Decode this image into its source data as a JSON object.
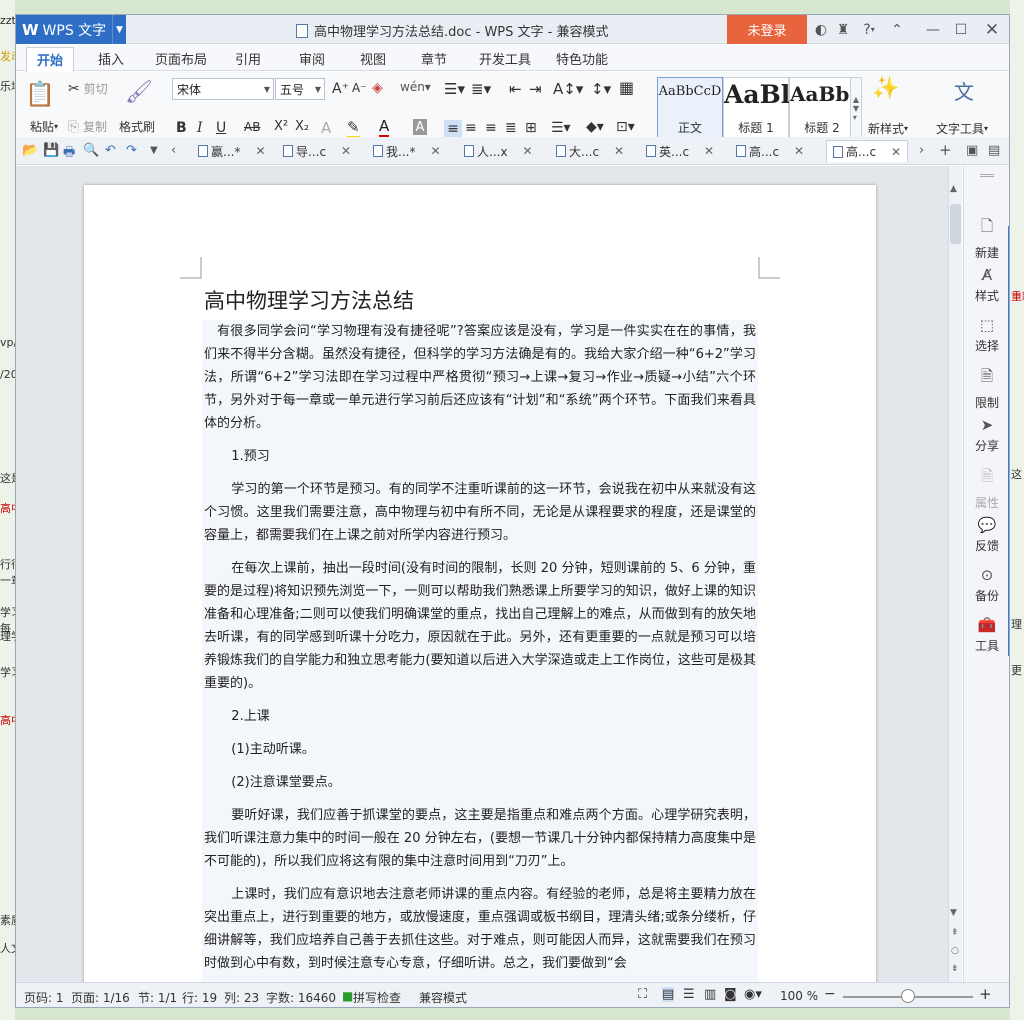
{
  "background": {
    "left_fragments": [
      "zzt",
      "发动",
      "乐培",
      "vp/2",
      "/20",
      "这是",
      "高中",
      "行很",
      "一章",
      "学习",
      "每",
      "理学",
      "学习",
      "高中",
      "素质",
      "人文"
    ],
    "right_fragments": [
      "重新",
      "这",
      "理",
      "更"
    ]
  },
  "titlebar": {
    "app_name": "WPS 文字",
    "doc_title": "高中物理学习方法总结.doc - WPS 文字 - 兼容模式",
    "login_label": "未登录",
    "help_label": "?"
  },
  "menu": {
    "items": [
      "开始",
      "插入",
      "页面布局",
      "引用",
      "审阅",
      "视图",
      "章节",
      "开发工具",
      "特色功能"
    ]
  },
  "ribbon": {
    "paste_label": "粘贴",
    "cut_label": "剪切",
    "copy_label": "复制",
    "format_painter_label": "格式刷",
    "font_name": "宋体",
    "font_size": "五号",
    "styles": [
      {
        "preview": "AaBbCcD",
        "label": "正文"
      },
      {
        "preview": "AaBl",
        "label": "标题 1"
      },
      {
        "preview": "AaBb(",
        "label": "标题 2"
      }
    ],
    "new_style_label": "新样式",
    "text_tools_label": "文字工具"
  },
  "tabs": [
    {
      "label": "赢...*",
      "active": false
    },
    {
      "label": "导...c",
      "active": false
    },
    {
      "label": "我...*",
      "active": false
    },
    {
      "label": "人...x",
      "active": false
    },
    {
      "label": "大...c",
      "active": false
    },
    {
      "label": "英...c",
      "active": false
    },
    {
      "label": "高...c",
      "active": false
    },
    {
      "label": "高...c",
      "active": true
    }
  ],
  "document": {
    "title": "高中物理学习方法总结",
    "paragraphs": [
      {
        "text": "有很多同学会问“学习物理有没有捷径呢”?答案应该是没有，学习是一件实实在在的事情，我们来不得半分含糊。虽然没有捷径，但科学的学习方法确是有的。我给大家介绍一种“6+2”学习法，所谓“6+2”学习法即在学习过程中严格贯彻“预习→上课→复习→作业→质疑→小结”六个环节，另外对于每一章或一单元进行学习前后还应该有“计划”和“系统”两个环节。下面我们来看具体的分析。",
        "indent": "small"
      },
      {
        "text": "1.预习",
        "indent": "big"
      },
      {
        "text": "学习的第一个环节是预习。有的同学不注重听课前的这一环节，会说我在初中从来就没有这个习惯。这里我们需要注意，高中物理与初中有所不同，无论是从课程要求的程度，还是课堂的容量上，都需要我们在上课之前对所学内容进行预习。",
        "indent": "big"
      },
      {
        "text": "在每次上课前，抽出一段时间(没有时间的限制，长则 20 分钟，短则课前的 5、6 分钟，重要的是过程)将知识预先浏览一下，一则可以帮助我们熟悉课上所要学习的知识，做好上课的知识准备和心理准备;二则可以使我们明确课堂的重点，找出自己理解上的难点，从而做到有的放矢地去听课，有的同学感到听课十分吃力，原因就在于此。另外，还有更重要的一点就是预习可以培养锻炼我们的自学能力和独立思考能力(要知道以后进入大学深造或走上工作岗位，这些可是极其重要的)。",
        "indent": "big"
      },
      {
        "text": "2.上课",
        "indent": "big"
      },
      {
        "text": "(1)主动听课。",
        "indent": "big"
      },
      {
        "text": "(2)注意课堂要点。",
        "indent": "big"
      },
      {
        "text": "要听好课，我们应善于抓课堂的要点，这主要是指重点和难点两个方面。心理学研究表明，我们听课注意力集中的时间一般在 20 分钟左右，(要想一节课几十分钟内都保持精力高度集中是不可能的)，所以我们应将这有限的集中注意时间用到“刀刃”上。",
        "indent": "big"
      },
      {
        "text": "上课时，我们应有意识地去注意老师讲课的重点内容。有经验的老师，总是将主要精力放在突出重点上，进行到重要的地方，或放慢速度，重点强调或板书纲目，理清头绪;或条分缕析，仔细讲解等，我们应培养自己善于去抓住这些。对于难点，则可能因人而异，这就需要我们在预习时做到心中有数，到时候注意专心专意，仔细听讲。总之，我们要做到“会",
        "indent": "big"
      }
    ]
  },
  "sidepanel": {
    "items": [
      {
        "icon": "new-icon",
        "label": "新建",
        "enabled": true
      },
      {
        "icon": "style-icon",
        "label": "样式",
        "enabled": true
      },
      {
        "icon": "select-icon",
        "label": "选择",
        "enabled": true
      },
      {
        "icon": "restrict-icon",
        "label": "限制",
        "enabled": true
      },
      {
        "icon": "share-icon",
        "label": "分享",
        "enabled": true
      },
      {
        "icon": "properties-icon",
        "label": "属性",
        "enabled": false
      },
      {
        "icon": "feedback-icon",
        "label": "反馈",
        "enabled": true
      },
      {
        "icon": "backup-icon",
        "label": "备份",
        "enabled": true
      },
      {
        "icon": "toolbox-icon",
        "label": "工具",
        "enabled": true
      }
    ]
  },
  "status": {
    "page": "页码: 1",
    "pages": "页面: 1/16",
    "section": "节: 1/1",
    "row": "行: 19",
    "col": "列: 23",
    "words": "字数: 16460",
    "spellcheck": "拼写检查",
    "mode": "兼容模式",
    "zoom": "100 %",
    "zoom_minus": "−",
    "zoom_plus": "+",
    "zoom_fraction": 0.5
  },
  "colors": {
    "accent": "#2e6fc5",
    "login": "#e8643c",
    "text_highlight": "#f3f6fb"
  }
}
